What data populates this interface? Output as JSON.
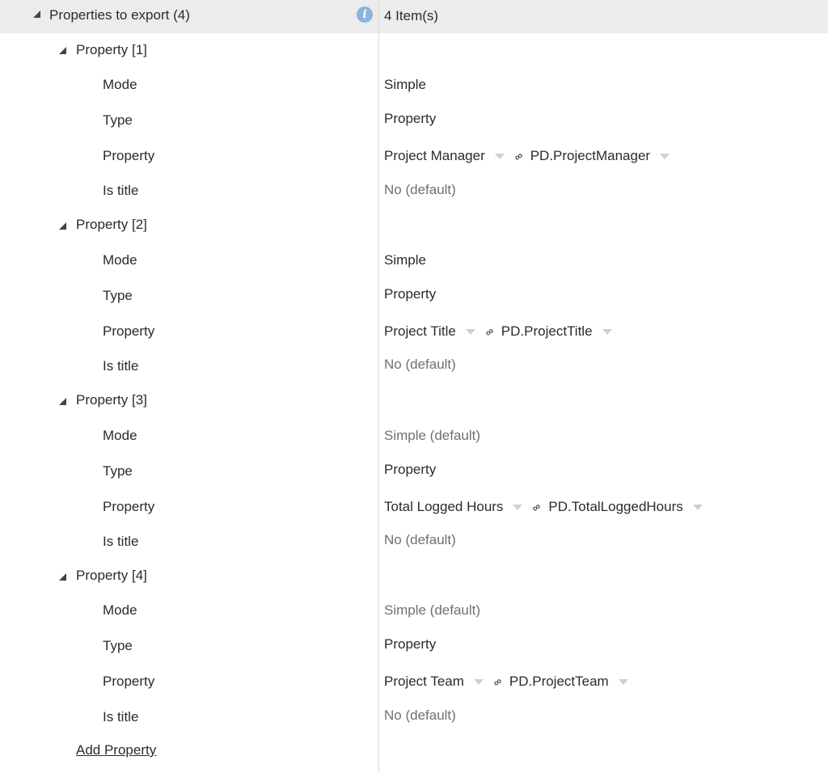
{
  "header": {
    "title": "Properties to export (4)",
    "count": "4 Item(s)"
  },
  "field_labels": {
    "mode": "Mode",
    "type": "Type",
    "property": "Property",
    "is_title": "Is title"
  },
  "properties": [
    {
      "heading": "Property [1]",
      "mode": "Simple",
      "mode_default": false,
      "type": "Property",
      "property_name": "Project Manager",
      "property_id": "PD.ProjectManager",
      "is_title": "No (default)"
    },
    {
      "heading": "Property [2]",
      "mode": "Simple",
      "mode_default": false,
      "type": "Property",
      "property_name": "Project Title",
      "property_id": "PD.ProjectTitle",
      "is_title": "No (default)"
    },
    {
      "heading": "Property [3]",
      "mode": "Simple (default)",
      "mode_default": true,
      "type": "Property",
      "property_name": "Total Logged Hours",
      "property_id": "PD.TotalLoggedHours",
      "is_title": "No (default)"
    },
    {
      "heading": "Property [4]",
      "mode": "Simple (default)",
      "mode_default": true,
      "type": "Property",
      "property_name": "Project Team",
      "property_id": "PD.ProjectTeam",
      "is_title": "No (default)"
    }
  ],
  "add_property_label": "Add Property",
  "colors": {
    "header_bg": "#ececec",
    "info_icon": "#8bb4dc",
    "default_text": "#707070",
    "divider": "#d6d6d6"
  }
}
